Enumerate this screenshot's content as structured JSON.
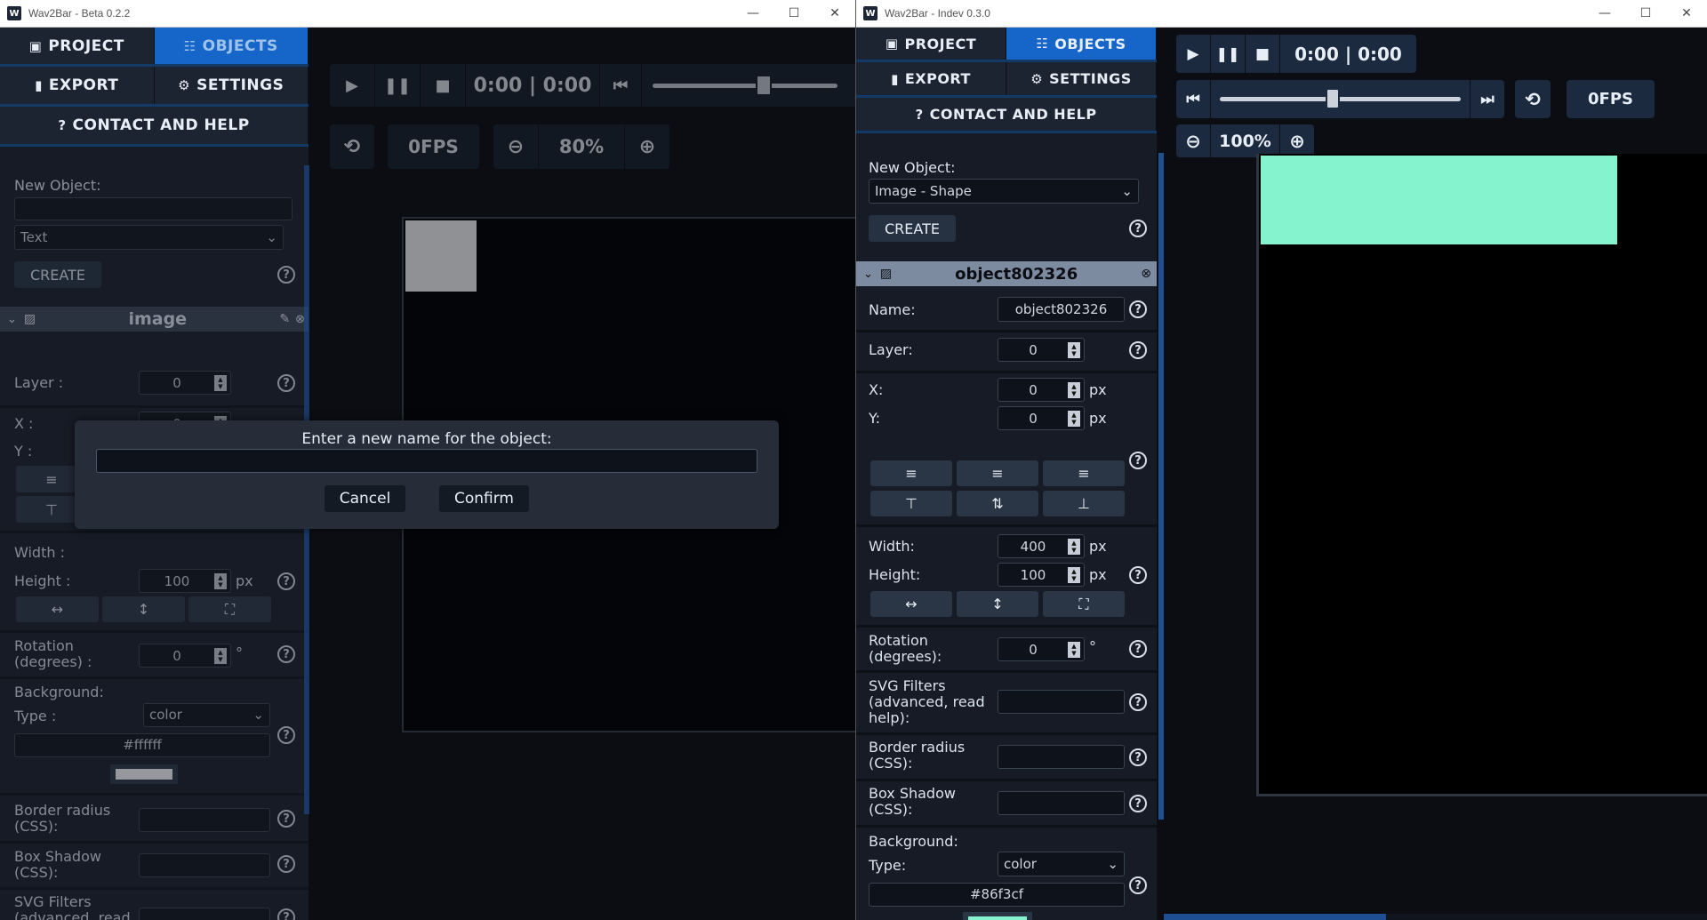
{
  "winA": {
    "title": "Wav2Bar - Beta 0.2.2",
    "tabs": {
      "project": "PROJECT",
      "objects": "OBJECTS",
      "export": "EXPORT",
      "settings": "SETTINGS",
      "contact": "CONTACT AND HELP"
    },
    "new_object_label": "New Object:",
    "new_object_type": "Text",
    "create": "CREATE",
    "object_name": "image",
    "layer_label": "Layer :",
    "layer_value": "0",
    "x_label": "X :",
    "x_value": "0",
    "y_label": "Y :",
    "unit_px": "px",
    "width_label": "Width :",
    "height_label": "Height :",
    "height_value": "100",
    "rotation_label": "Rotation (degrees) :",
    "rotation_value": "0",
    "deg": "°",
    "background_label": "Background:",
    "type_label": "Type :",
    "type_value": "color",
    "color_value": "#ffffff",
    "border_radius_label": "Border radius (CSS):",
    "box_shadow_label": "Box Shadow (CSS):",
    "svg_filters_label": "SVG Filters (advanced, read help):",
    "time": "0:00 | 0:00",
    "fps": "0FPS",
    "zoom": "80%",
    "dialog": {
      "prompt": "Enter a new name for the object:",
      "input_value": "",
      "cancel": "Cancel",
      "confirm": "Confirm"
    },
    "help": "?"
  },
  "winB": {
    "title": "Wav2Bar - Indev 0.3.0",
    "tabs": {
      "project": "PROJECT",
      "objects": "OBJECTS",
      "export": "EXPORT",
      "settings": "SETTINGS",
      "contact": "CONTACT AND HELP"
    },
    "new_object_label": "New Object:",
    "new_object_type": "Image - Shape",
    "create": "CREATE",
    "object_name": "object802326",
    "name_label": "Name:",
    "name_value": "object802326",
    "layer_label": "Layer:",
    "layer_value": "0",
    "x_label": "X:",
    "x_value": "0",
    "y_label": "Y:",
    "y_value": "0",
    "unit_px": "px",
    "width_label": "Width:",
    "width_value": "400",
    "height_label": "Height:",
    "height_value": "100",
    "rotation_label": "Rotation (degrees):",
    "rotation_value": "0",
    "deg": "°",
    "svg_filters_label": "SVG Filters (advanced, read help):",
    "border_radius_label": "Border radius (CSS):",
    "box_shadow_label": "Box Shadow (CSS):",
    "background_label": "Background:",
    "type_label": "Type:",
    "type_value": "color",
    "color_value": "#86f3cf",
    "time": "0:00 | 0:00",
    "fps": "0FPS",
    "zoom": "100%",
    "help": "?"
  },
  "colors": {
    "accent": "#1566c8",
    "swatchA": "#ffffff",
    "swatchB": "#86f3cf",
    "shape": "#86f3cf"
  }
}
